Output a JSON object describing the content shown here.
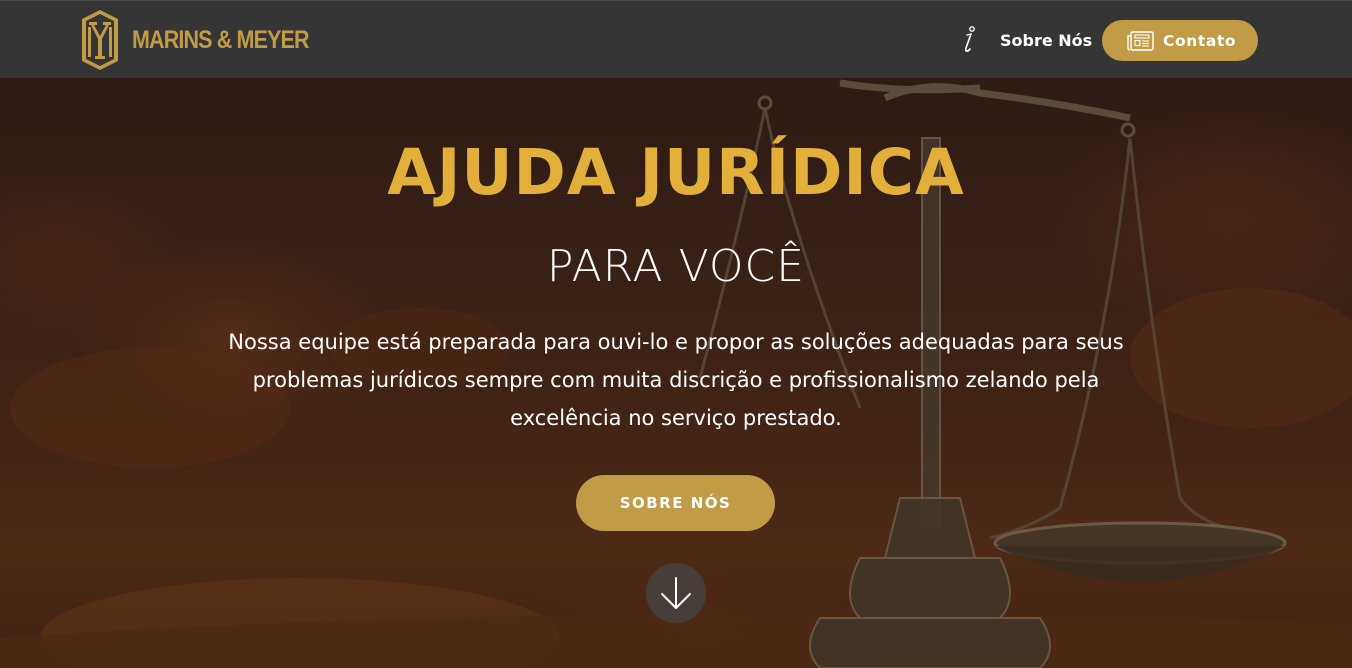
{
  "brand": {
    "logo_text": "MARINS & MEYER",
    "color": "#c19b45"
  },
  "nav": {
    "about_label": "Sobre Nós",
    "about_icon": "info-icon",
    "contact_label": "Contato",
    "contact_icon": "newspaper-icon"
  },
  "hero": {
    "title": "AJUDA JURÍDICA",
    "subtitle": "PARA VOCÊ",
    "text": "Nossa equipe está preparada para ouvi-lo e propor as soluções adequadas para seus problemas jurídicos sempre com muita discrição e profissionalismo zelando pela excelência no serviço prestado.",
    "button_label": "SOBRE NÓS",
    "scroll_icon": "arrow-down-icon",
    "title_color": "#e2b03a",
    "background_image": "scales-of-justice"
  }
}
